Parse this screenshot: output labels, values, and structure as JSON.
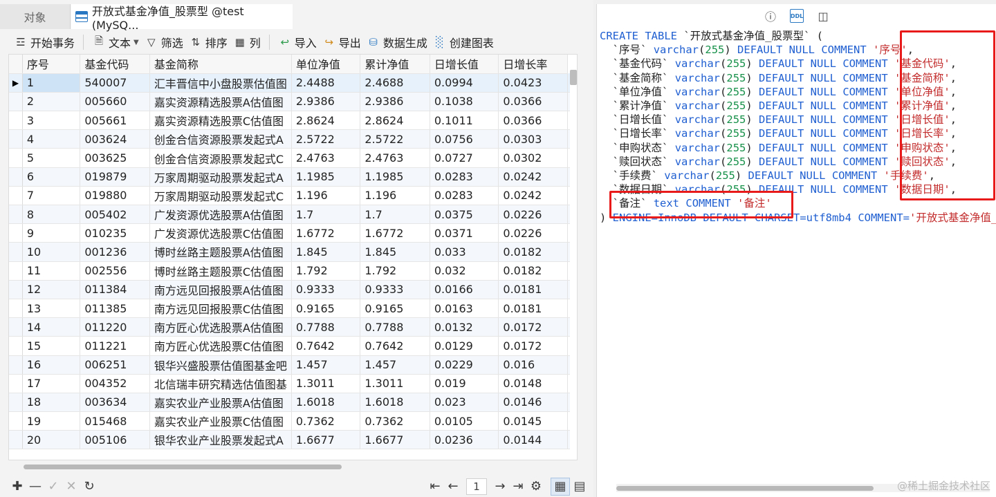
{
  "tabs": {
    "objects": "对象",
    "table": "开放式基金净值_股票型 @test (MySQ..."
  },
  "toolbar": {
    "begin_transaction": "开始事务",
    "text": "文本",
    "filter": "筛选",
    "sort": "排序",
    "columns": "列",
    "import": "导入",
    "export": "导出",
    "generate_data": "数据生成",
    "create_chart": "创建图表"
  },
  "grid": {
    "columns": [
      "序号",
      "基金代码",
      "基金简称",
      "单位净值",
      "累计净值",
      "日增长值",
      "日增长率"
    ],
    "rows": [
      [
        "1",
        "540007",
        "汇丰晋信中小盘股票估值图",
        "2.4488",
        "2.4688",
        "0.0994",
        "0.0423"
      ],
      [
        "2",
        "005660",
        "嘉实资源精选股票A估值图",
        "2.9386",
        "2.9386",
        "0.1038",
        "0.0366"
      ],
      [
        "3",
        "005661",
        "嘉实资源精选股票C估值图",
        "2.8624",
        "2.8624",
        "0.1011",
        "0.0366"
      ],
      [
        "4",
        "003624",
        "创金合信资源股票发起式A",
        "2.5722",
        "2.5722",
        "0.0756",
        "0.0303"
      ],
      [
        "5",
        "003625",
        "创金合信资源股票发起式C",
        "2.4763",
        "2.4763",
        "0.0727",
        "0.0302"
      ],
      [
        "6",
        "019879",
        "万家周期驱动股票发起式A",
        "1.1985",
        "1.1985",
        "0.0283",
        "0.0242"
      ],
      [
        "7",
        "019880",
        "万家周期驱动股票发起式C",
        "1.196",
        "1.196",
        "0.0283",
        "0.0242"
      ],
      [
        "8",
        "005402",
        "广发资源优选股票A估值图",
        "1.7",
        "1.7",
        "0.0375",
        "0.0226"
      ],
      [
        "9",
        "010235",
        "广发资源优选股票C估值图",
        "1.6772",
        "1.6772",
        "0.0371",
        "0.0226"
      ],
      [
        "10",
        "001236",
        "博时丝路主题股票A估值图",
        "1.845",
        "1.845",
        "0.033",
        "0.0182"
      ],
      [
        "11",
        "002556",
        "博时丝路主题股票C估值图",
        "1.792",
        "1.792",
        "0.032",
        "0.0182"
      ],
      [
        "12",
        "011384",
        "南方远见回报股票A估值图",
        "0.9333",
        "0.9333",
        "0.0166",
        "0.0181"
      ],
      [
        "13",
        "011385",
        "南方远见回报股票C估值图",
        "0.9165",
        "0.9165",
        "0.0163",
        "0.0181"
      ],
      [
        "14",
        "011220",
        "南方匠心优选股票A估值图",
        "0.7788",
        "0.7788",
        "0.0132",
        "0.0172"
      ],
      [
        "15",
        "011221",
        "南方匠心优选股票C估值图",
        "0.7642",
        "0.7642",
        "0.0129",
        "0.0172"
      ],
      [
        "16",
        "006251",
        "银华兴盛股票估值图基金吧",
        "1.457",
        "1.457",
        "0.0229",
        "0.016"
      ],
      [
        "17",
        "004352",
        "北信瑞丰研究精选估值图基",
        "1.3011",
        "1.3011",
        "0.019",
        "0.0148"
      ],
      [
        "18",
        "003634",
        "嘉实农业产业股票A估值图",
        "1.6018",
        "1.6018",
        "0.023",
        "0.0146"
      ],
      [
        "19",
        "015468",
        "嘉实农业产业股票C估值图",
        "0.7362",
        "0.7362",
        "0.0105",
        "0.0145"
      ],
      [
        "20",
        "005106",
        "银华农业产业股票发起式A",
        "1.6677",
        "1.6677",
        "0.0236",
        "0.0144"
      ]
    ]
  },
  "footer": {
    "page": "1"
  },
  "ddl": {
    "create_kw": "CREATE TABLE",
    "table_name": "`开放式基金净值_股票型`",
    "columns": [
      {
        "name": "`序号`",
        "type": "varchar",
        "len": "255",
        "comment": "'序号'"
      },
      {
        "name": "`基金代码`",
        "type": "varchar",
        "len": "255",
        "comment": "'基金代码'"
      },
      {
        "name": "`基金简称`",
        "type": "varchar",
        "len": "255",
        "comment": "'基金简称'"
      },
      {
        "name": "`单位净值`",
        "type": "varchar",
        "len": "255",
        "comment": "'单位净值'"
      },
      {
        "name": "`累计净值`",
        "type": "varchar",
        "len": "255",
        "comment": "'累计净值'"
      },
      {
        "name": "`日增长值`",
        "type": "varchar",
        "len": "255",
        "comment": "'日增长值'"
      },
      {
        "name": "`日增长率`",
        "type": "varchar",
        "len": "255",
        "comment": "'日增长率'"
      },
      {
        "name": "`申购状态`",
        "type": "varchar",
        "len": "255",
        "comment": "'申购状态'"
      },
      {
        "name": "`赎回状态`",
        "type": "varchar",
        "len": "255",
        "comment": "'赎回状态'"
      },
      {
        "name": "`手续费`",
        "type": "varchar",
        "len": "255",
        "comment": "'手续费'"
      },
      {
        "name": "`数据日期`",
        "type": "varchar",
        "len": "255",
        "comment": "'数据日期'"
      }
    ],
    "last_col": {
      "name": "`备注`",
      "type": "text",
      "comment": "'备注'"
    },
    "engine_line": {
      "engine": "ENGINE=InnoDB",
      "charset": "DEFAULT CHARSET=utf8mb4",
      "comment_kw": "COMMENT=",
      "comment": "'开放式基金净值_股票型'"
    }
  },
  "watermark": "@稀土掘金技术社区",
  "colors": {
    "keyword": "#1f5fd1",
    "number": "#17914a",
    "string": "#c32c2c",
    "highlight_box": "#e81a1a"
  },
  "icons": [
    "info-icon",
    "ddl-icon",
    "layout-icon",
    "begin-transaction-icon",
    "text-icon",
    "filter-icon",
    "sort-icon",
    "columns-icon",
    "import-icon",
    "export-icon",
    "generate-data-icon",
    "chart-icon"
  ]
}
